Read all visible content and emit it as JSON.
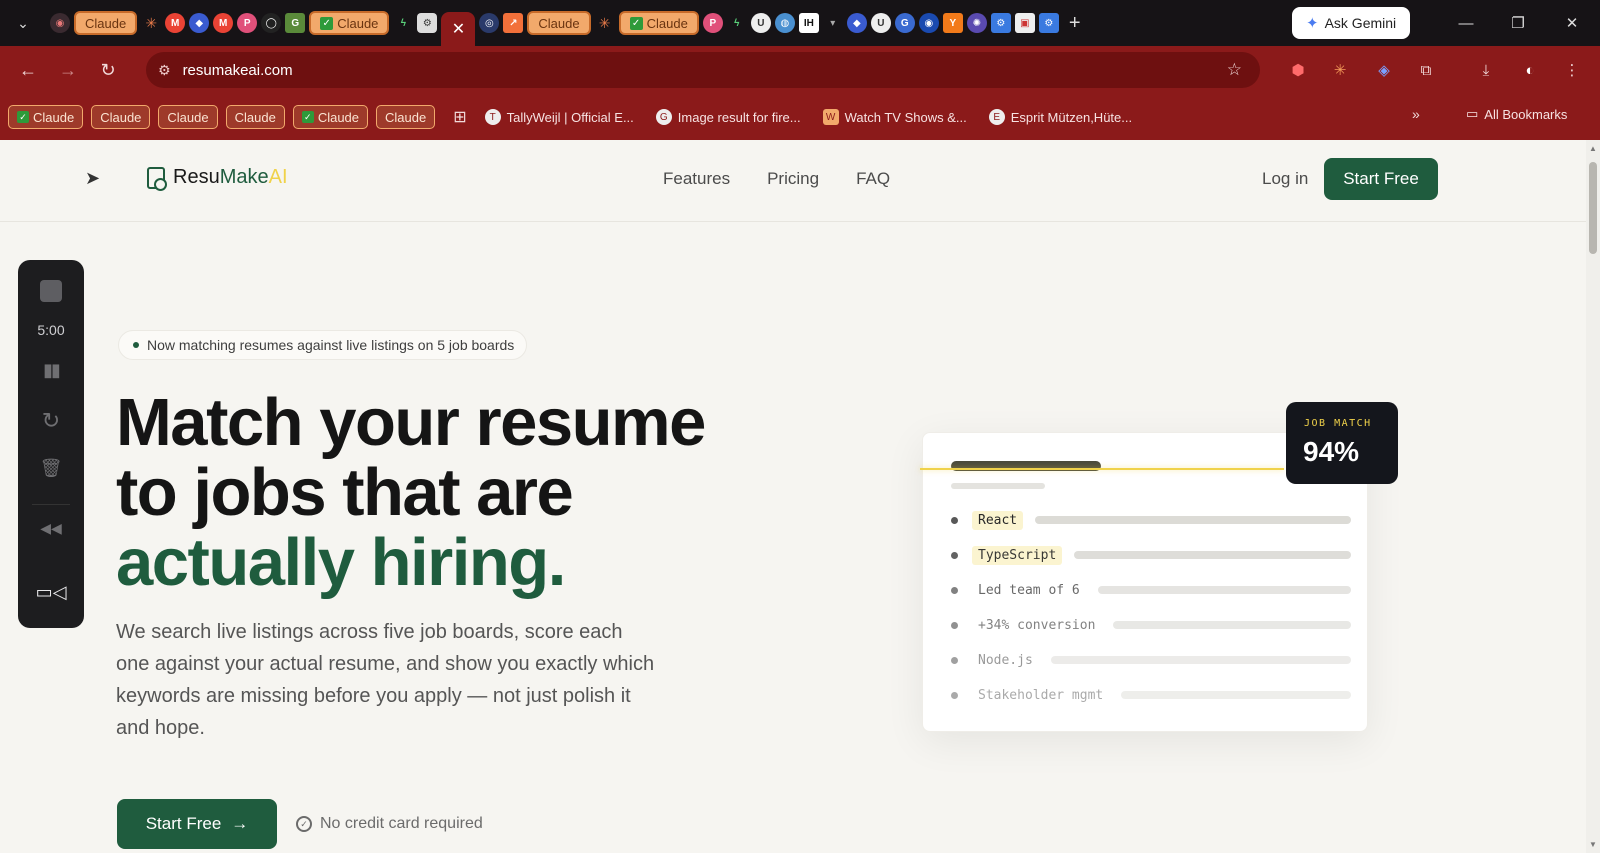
{
  "browser": {
    "tabs_claude_label": "Claude",
    "active_tab_close": "✕",
    "new_tab": "+",
    "ask_gemini": "Ask Gemini",
    "url": "resumakeai.com",
    "bookmarks_claude": [
      "Claude",
      "Claude",
      "Claude",
      "Claude",
      "Claude",
      "Claude"
    ],
    "bookmark_links": [
      {
        "label": "TallyWeijl | Official E...",
        "icon": "T"
      },
      {
        "label": "Image result for fire...",
        "icon": "G"
      },
      {
        "label": "Watch TV Shows &...",
        "icon": "W"
      },
      {
        "label": "Esprit Mützen,Hüte...",
        "icon": "E"
      }
    ],
    "more_bookmarks": "»",
    "all_bookmarks": "All Bookmarks"
  },
  "site": {
    "brand_main": "Resu",
    "brand_accent": "Make",
    "brand_ai": "AI",
    "nav": [
      "Features",
      "Pricing",
      "FAQ"
    ],
    "login": "Log in",
    "start_free": "Start Free"
  },
  "recorder": {
    "timer": "5:00"
  },
  "hero": {
    "badge": "Now matching resumes against live listings on 5 job boards",
    "headline_line1": "Match your resume",
    "headline_line2": "to jobs that are",
    "headline_line3": "actually hiring.",
    "subtext": "We search live listings across five job boards, score each one against your actual resume, and show you exactly which keywords are missing before you apply — not just polish it and hope.",
    "cta": "Start Free",
    "cta_arrow": "→",
    "no_card": "No credit card required"
  },
  "card": {
    "keywords": [
      {
        "text": "React",
        "level": 1.0
      },
      {
        "text": "TypeScript",
        "level": 0.9
      },
      {
        "text": "Led team of 6",
        "level": 0.6
      },
      {
        "text": "+34% conversion",
        "level": 0.45
      },
      {
        "text": "Node.js",
        "level": 0.3
      },
      {
        "text": "Stakeholder mgmt",
        "level": 0.2
      }
    ],
    "match_label": "JOB MATCH",
    "match_value": "94%"
  },
  "colors": {
    "brand_green": "#1f5c3e",
    "accent_yellow": "#f0d24a",
    "browser_red": "#8b1a1a"
  }
}
